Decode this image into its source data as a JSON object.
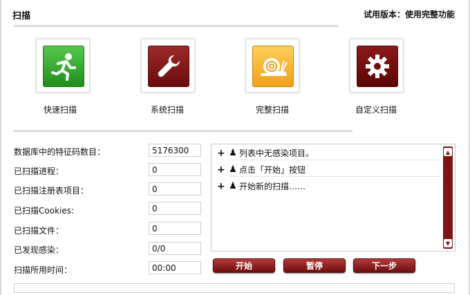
{
  "header": {
    "title": "扫描",
    "edition": "试用版本：使用完整功能"
  },
  "scan_types": [
    {
      "label": "快速扫描",
      "icon": "running-man-icon",
      "color": "#2a9a25"
    },
    {
      "label": "系统扫描",
      "icon": "wrench-icon",
      "color": "#7e1a1a"
    },
    {
      "label": "完整扫描",
      "icon": "snail-icon",
      "color": "#f4a820"
    },
    {
      "label": "自定义扫描",
      "icon": "gear-icon",
      "color": "#6e0c0c"
    }
  ],
  "stats": [
    {
      "label": "数据库中的特征码数目：",
      "value": "5176300"
    },
    {
      "label": "已扫描进程：",
      "value": "0"
    },
    {
      "label": "已扫描注册表项目：",
      "value": "0"
    },
    {
      "label": "已扫描Cookies:",
      "value": "0"
    },
    {
      "label": "已扫描文件：",
      "value": "0"
    },
    {
      "label": "已发现感染：",
      "value": "0/0"
    },
    {
      "label": "扫描所用时间：",
      "value": "00:00"
    }
  ],
  "log": [
    {
      "text": "列表中无感染项目。",
      "icon": "spy-icon"
    },
    {
      "text": "点击「开始」按钮",
      "icon": "spy-icon"
    },
    {
      "text": "开始新的扫描……",
      "icon": "spy-icon"
    }
  ],
  "actions": {
    "start": "开始",
    "pause": "暂停",
    "next": "下一步"
  }
}
